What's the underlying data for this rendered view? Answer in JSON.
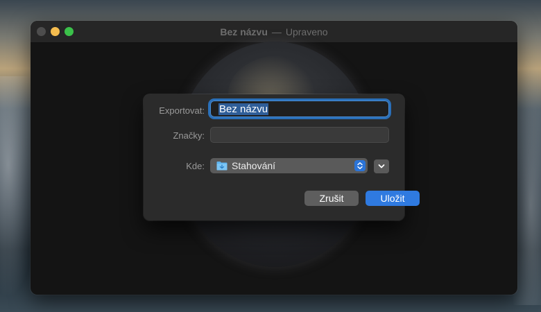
{
  "window": {
    "title": "Bez názvu",
    "separator": "—",
    "status": "Upraveno"
  },
  "dialog": {
    "export_label": "Exportovat:",
    "filename_value": "Bez názvu",
    "tags_label": "Značky:",
    "tags_value": "",
    "where_label": "Kde:",
    "where_value": "Stahování",
    "where_icon": "folder-icon",
    "cancel_label": "Zrušit",
    "save_label": "Uložit"
  },
  "colors": {
    "accent": "#2f7ae0",
    "traffic_min": "#f5bd4f",
    "traffic_max": "#3bc14a"
  }
}
